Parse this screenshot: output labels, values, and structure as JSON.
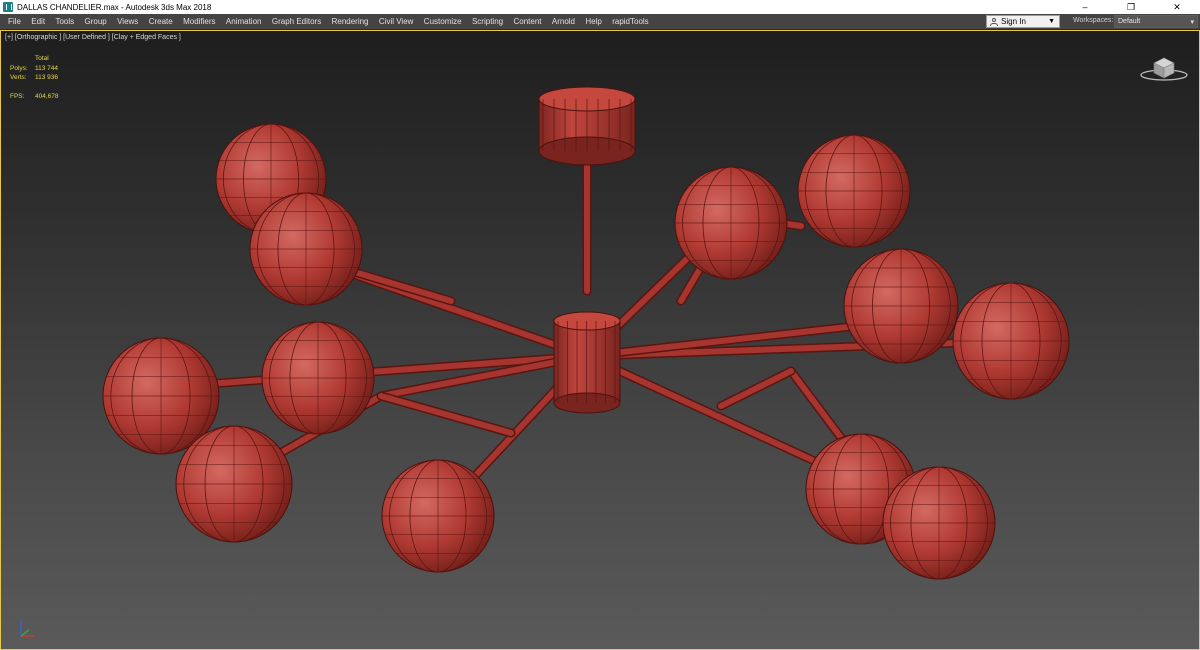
{
  "window": {
    "title": "DALLAS CHANDELIER.max - Autodesk 3ds Max 2018",
    "controls": [
      "–",
      "❐",
      "✕"
    ]
  },
  "menu": [
    "File",
    "Edit",
    "Tools",
    "Group",
    "Views",
    "Create",
    "Modifiers",
    "Animation",
    "Graph Editors",
    "Rendering",
    "Civil View",
    "Customize",
    "Scripting",
    "Content",
    "Arnold",
    "Help",
    "rapidTools"
  ],
  "signin": {
    "label": "Sign In",
    "caret": "▼"
  },
  "workspaces": {
    "label": "Workspaces:",
    "value": "Default",
    "caret": "▾"
  },
  "viewport": {
    "label": "[+] [Orthographic ] [User Defined ] [Clay + Edged Faces ]",
    "stats": {
      "header": "Total",
      "polys_label": "Polys:",
      "polys_value": "113 744",
      "verts_label": "Verts:",
      "verts_value": "113 936",
      "fps_label": "FPS:",
      "fps_value": "404,678"
    }
  },
  "colors": {
    "model": "#b03a33",
    "wire": "#5a1510",
    "stats_text": "#e8d84a",
    "viewport_border": "#e6c84b"
  }
}
